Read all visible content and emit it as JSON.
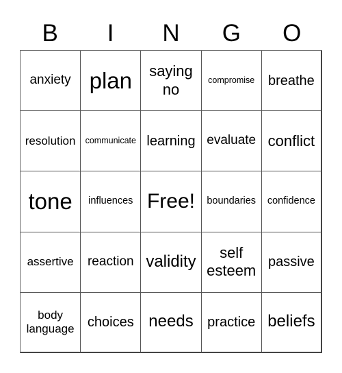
{
  "header": {
    "letters": [
      "B",
      "I",
      "N",
      "G",
      "O"
    ]
  },
  "board": {
    "cells": [
      [
        "anxiety",
        "plan",
        "saying no",
        "compromise",
        "breathe"
      ],
      [
        "resolution",
        "communicate",
        "learning",
        "evaluate",
        "conflict"
      ],
      [
        "tone",
        "influences",
        "Free!",
        "boundaries",
        "confidence"
      ],
      [
        "assertive",
        "reaction",
        "validity",
        "self esteem",
        "passive"
      ],
      [
        "body language",
        "choices",
        "needs",
        "practice",
        "beliefs"
      ]
    ],
    "free_space": "Free!"
  }
}
